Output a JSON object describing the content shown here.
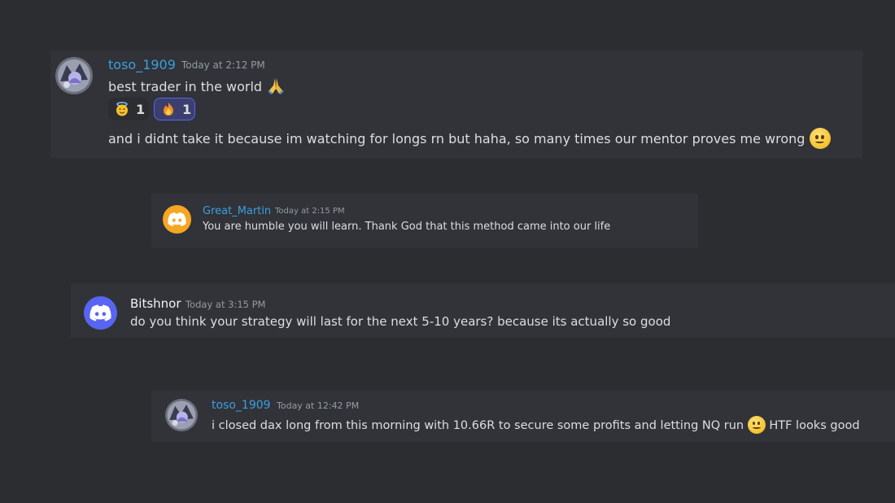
{
  "messages": [
    {
      "username": "toso_1909",
      "timestamp": "Today at 2:12 PM",
      "lines": [
        "best trader in the world",
        "and i didnt take it because im watching for longs rn but haha, so many times our mentor proves me wrong"
      ],
      "emojis": [
        "folded-hands-emoji",
        "slightly-smiling-face-emoji"
      ],
      "reactions": [
        {
          "emoji": "smiling-face-with-halo-emoji",
          "count": "1",
          "active": false
        },
        {
          "emoji": "fire-emoji",
          "count": "1",
          "active": true
        }
      ]
    },
    {
      "username": "Great_Martin",
      "timestamp": "Today at 2:15 PM",
      "lines": [
        "You are humble you will learn. Thank God that this method came into our life"
      ],
      "avatar": "discord-logo-avatar-orange"
    },
    {
      "username": "Bitshnor",
      "timestamp": "Today at 3:15 PM",
      "lines": [
        "do you think your strategy will last for the next 5-10 years? because its actually so good"
      ],
      "avatar": "discord-logo-avatar-blurple"
    },
    {
      "username": "toso_1909",
      "timestamp": "Today at 12:42 PM",
      "lines": [
        "i closed dax long from this morning with 10.66R to secure some profits and letting NQ run",
        "HTF looks good"
      ],
      "emojis": [
        "slightly-smiling-face-emoji"
      ]
    }
  ],
  "colors": {
    "background": "#2b2d31",
    "card": "#313338",
    "username_blue": "#3b9fe1",
    "username_white": "#f2f3f5",
    "timestamp": "#949ba4",
    "text": "#dbdee1",
    "blurple": "#5865f2",
    "orange": "#f5a623"
  }
}
